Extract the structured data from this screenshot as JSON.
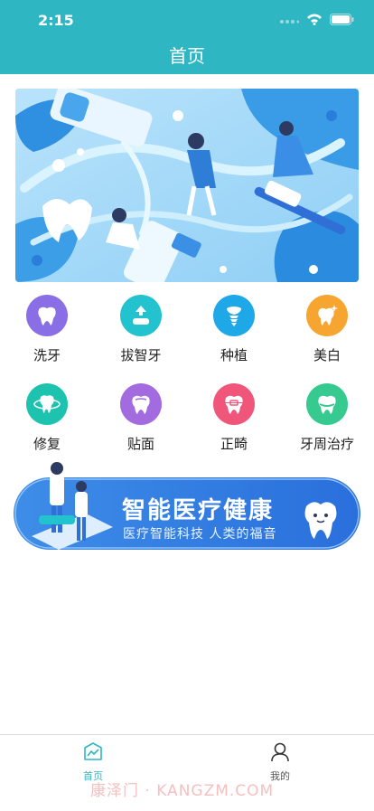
{
  "status_bar": {
    "time": "2:15"
  },
  "nav": {
    "title": "首页"
  },
  "services": [
    {
      "label": "洗牙",
      "color": "#8a6ee6",
      "icon": "tooth-icon"
    },
    {
      "label": "拔智牙",
      "color": "#22c3cf",
      "icon": "tooth-extract-icon"
    },
    {
      "label": "种植",
      "color": "#1fa8e8",
      "icon": "implant-icon"
    },
    {
      "label": "美白",
      "color": "#f7a531",
      "icon": "tooth-sparkle-icon"
    },
    {
      "label": "修复",
      "color": "#1ec3b0",
      "icon": "tooth-ring-icon"
    },
    {
      "label": "贴面",
      "color": "#a36be0",
      "icon": "tooth-veneer-icon"
    },
    {
      "label": "正畸",
      "color": "#f0567a",
      "icon": "braces-icon"
    },
    {
      "label": "牙周治疗",
      "color": "#36c990",
      "icon": "tooth-gum-icon"
    }
  ],
  "promo": {
    "title": "智能医疗健康",
    "subtitle": "医疗智能科技 人类的福音"
  },
  "tabbar": {
    "home_label": "首页",
    "mine_label": "我的",
    "active_color": "#2fb6c3"
  },
  "watermark": "康泽门 · KANGZM.COM"
}
